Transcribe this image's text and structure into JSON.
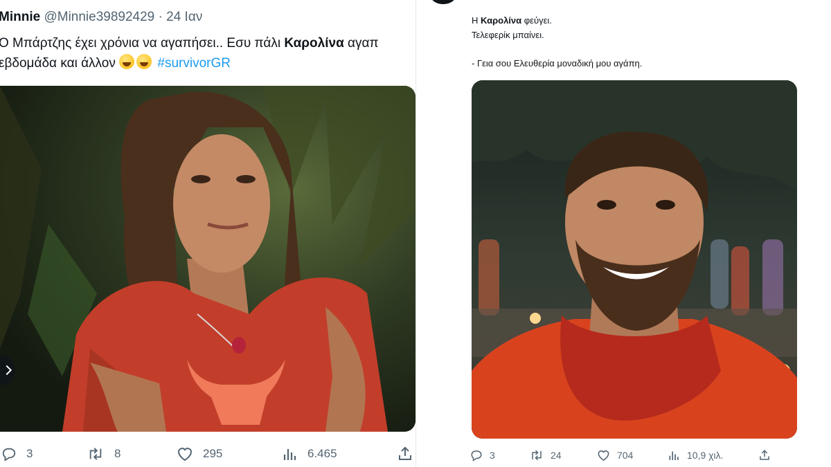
{
  "left_tweet": {
    "author_name": "Minnie",
    "author_handle": "@Minnie39892429",
    "separator": "·",
    "date": "24 Ιαν",
    "text_line1_before": "Ο Μπάρτζης έχει χρόνια να αγαπήσει.. Εσυ πάλι ",
    "text_line1_bold": "Καρολίνα",
    "text_line1_after": " αγαπ",
    "text_line2": "εβδομάδα και άλλον ",
    "hashtag": "#survivorGR",
    "emojis": [
      "joy-emoji",
      "joy-emoji"
    ],
    "image_label": "woman-in-red-shirt-photo",
    "stats": {
      "replies": "3",
      "retweets": "8",
      "likes": "295",
      "views": "6.465"
    }
  },
  "right_tweet": {
    "line1_before": "Η ",
    "line1_bold": "Καρολίνα",
    "line1_after": " φεύγει.",
    "line2": "Τελεφερίκ μπαίνει.",
    "line3": "- Γεια σου Ελευθερία μοναδική μου αγάπη.",
    "image_label": "smiling-bearded-man-photo",
    "stats": {
      "replies": "3",
      "retweets": "24",
      "likes": "704",
      "views": "10,9 χιλ."
    }
  },
  "colors": {
    "text": "#0f1419",
    "secondary": "#536471",
    "link": "#1d9bf0"
  }
}
